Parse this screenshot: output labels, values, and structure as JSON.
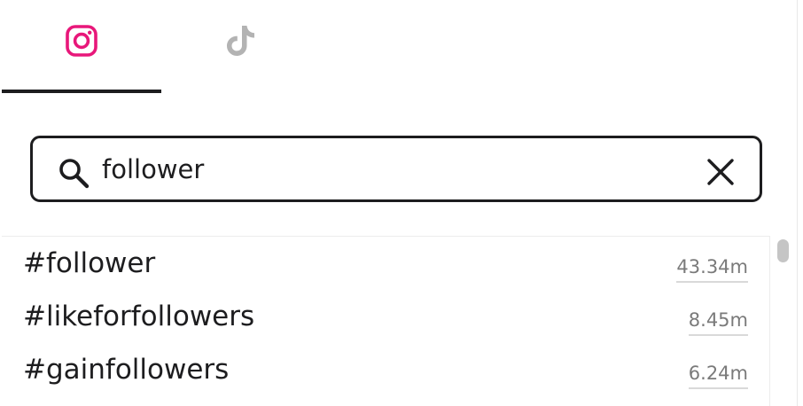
{
  "tabs": [
    {
      "id": "instagram",
      "icon": "instagram-icon",
      "active": true,
      "color": "#e8177a"
    },
    {
      "id": "tiktok",
      "icon": "tiktok-icon",
      "active": false,
      "color": "#b3b3b3"
    }
  ],
  "search": {
    "value": "follower",
    "icon": "search-icon",
    "clear_icon": "close-icon"
  },
  "results": [
    {
      "tag": "#follower",
      "count": "43.34m"
    },
    {
      "tag": "#likeforfollowers",
      "count": "8.45m"
    },
    {
      "tag": "#gainfollowers",
      "count": "6.24m"
    }
  ],
  "colors": {
    "accent": "#e8177a",
    "text": "#1d1d1f",
    "muted": "#7a7a7a"
  }
}
